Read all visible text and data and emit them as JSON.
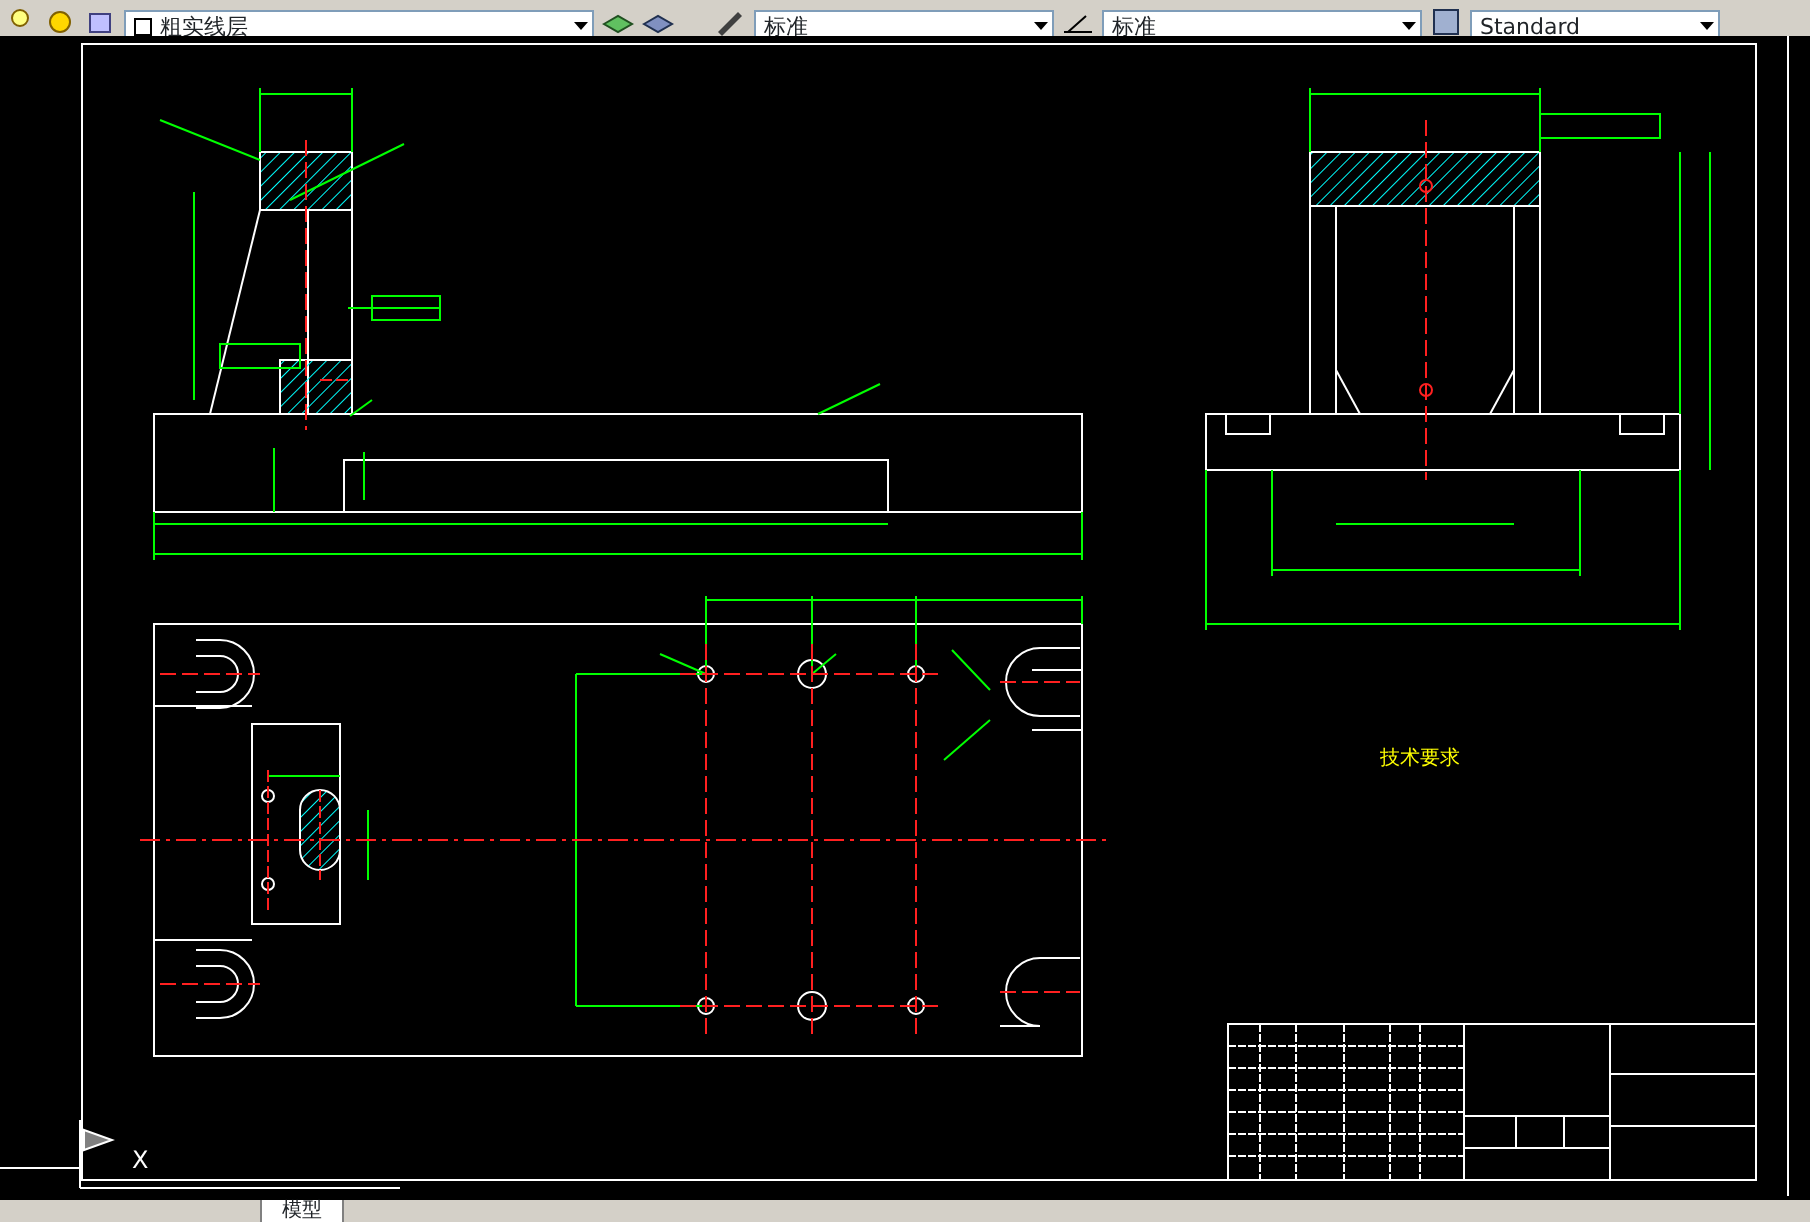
{
  "toolbar": {
    "layer_name": "粗实线层",
    "text_style": "标准",
    "dim_style": "标准",
    "table_style": "Standard"
  },
  "drawing": {
    "notes_title": "技术要求",
    "ucs_label": "X"
  },
  "layout_tabs": [
    {
      "label": "模型",
      "selected": true
    }
  ]
}
